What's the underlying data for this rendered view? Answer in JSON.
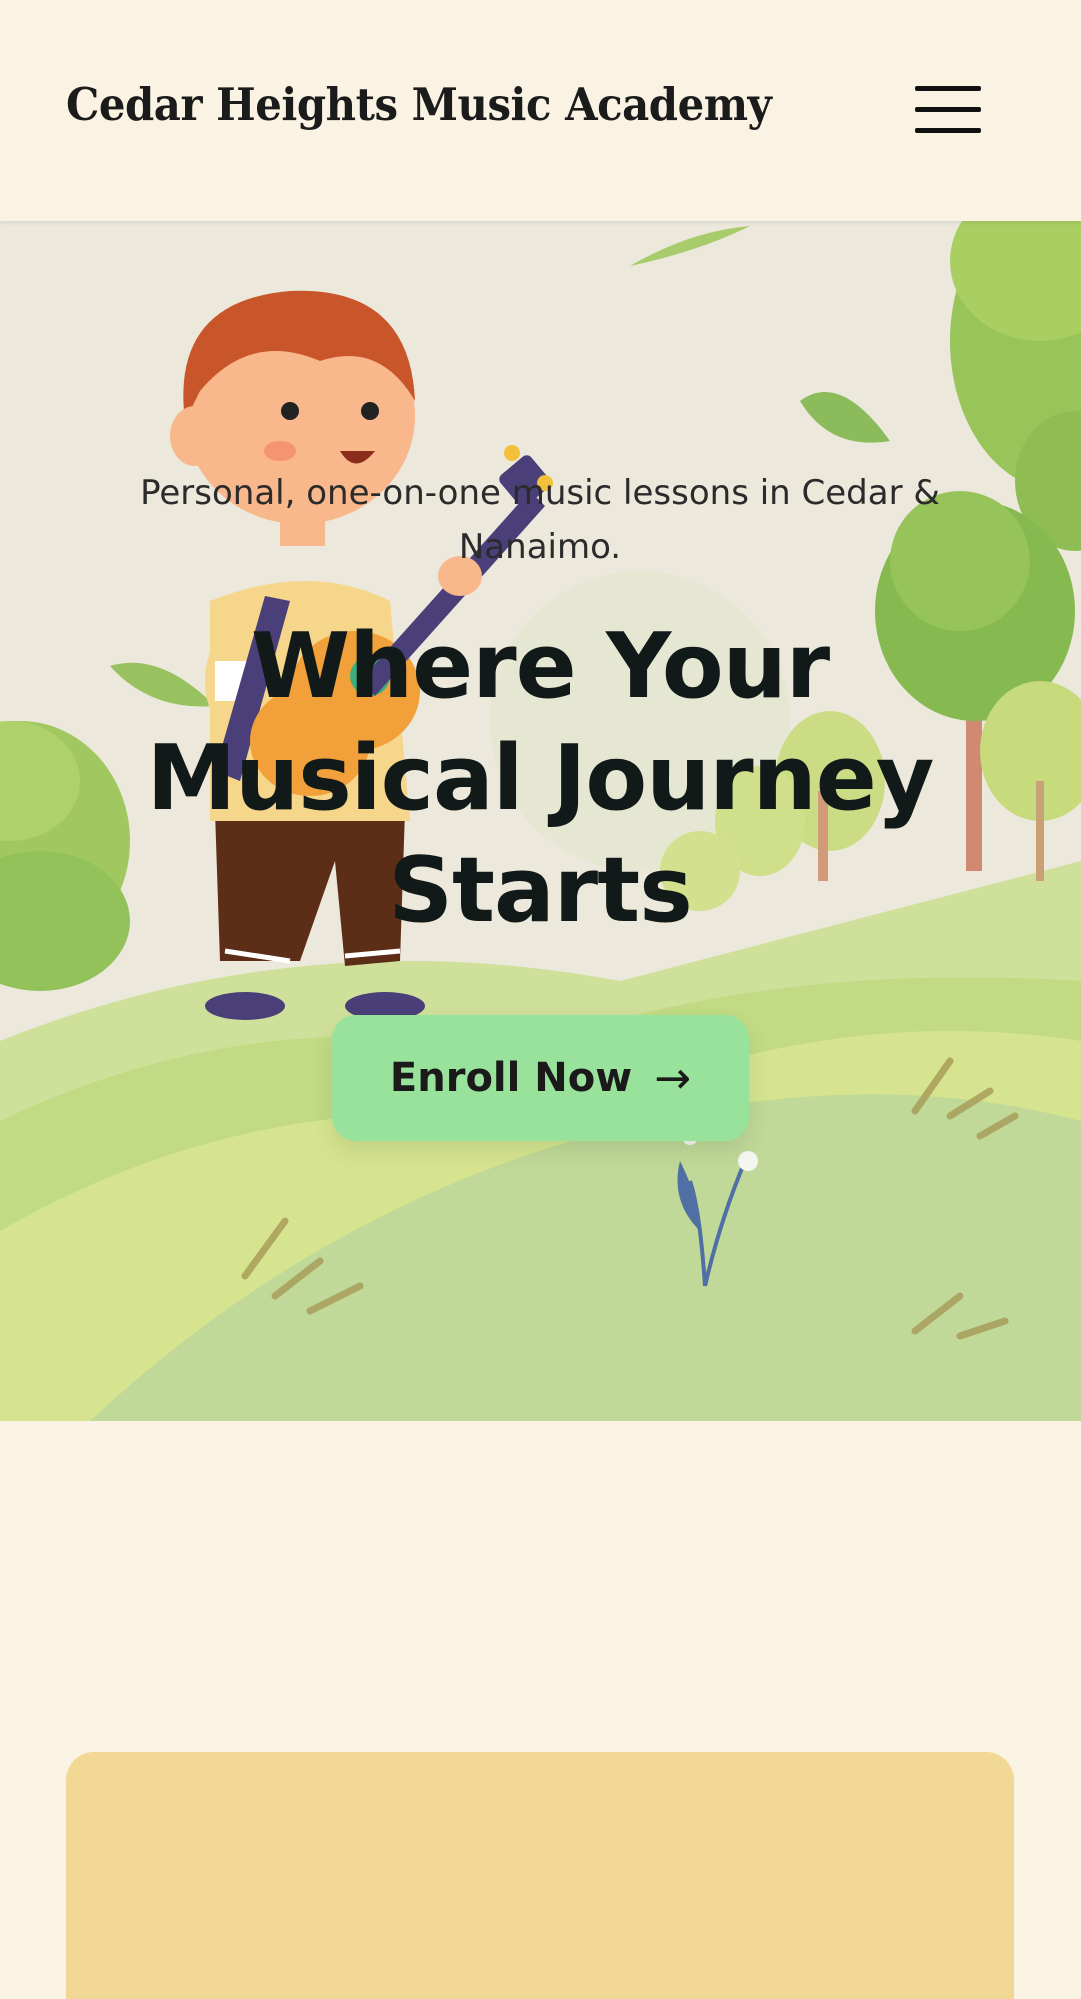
{
  "header": {
    "brand": "Cedar Heights Music Academy",
    "menu_icon": "hamburger-menu-icon"
  },
  "hero": {
    "subtitle": "Personal, one-on-one music lessons in Cedar & Nanaimo.",
    "headline_line1": "Where Your",
    "headline_line2": "Musical Journey",
    "headline_line3": "Starts",
    "cta_label": "Enroll Now",
    "cta_arrow": "→",
    "illustration": "child-playing-guitar-in-park"
  },
  "colors": {
    "background": "#faf3e4",
    "cta": "#98e29c",
    "card": "#f2d895",
    "grass": "#c8dc8a",
    "tree": "#8cbd52"
  }
}
